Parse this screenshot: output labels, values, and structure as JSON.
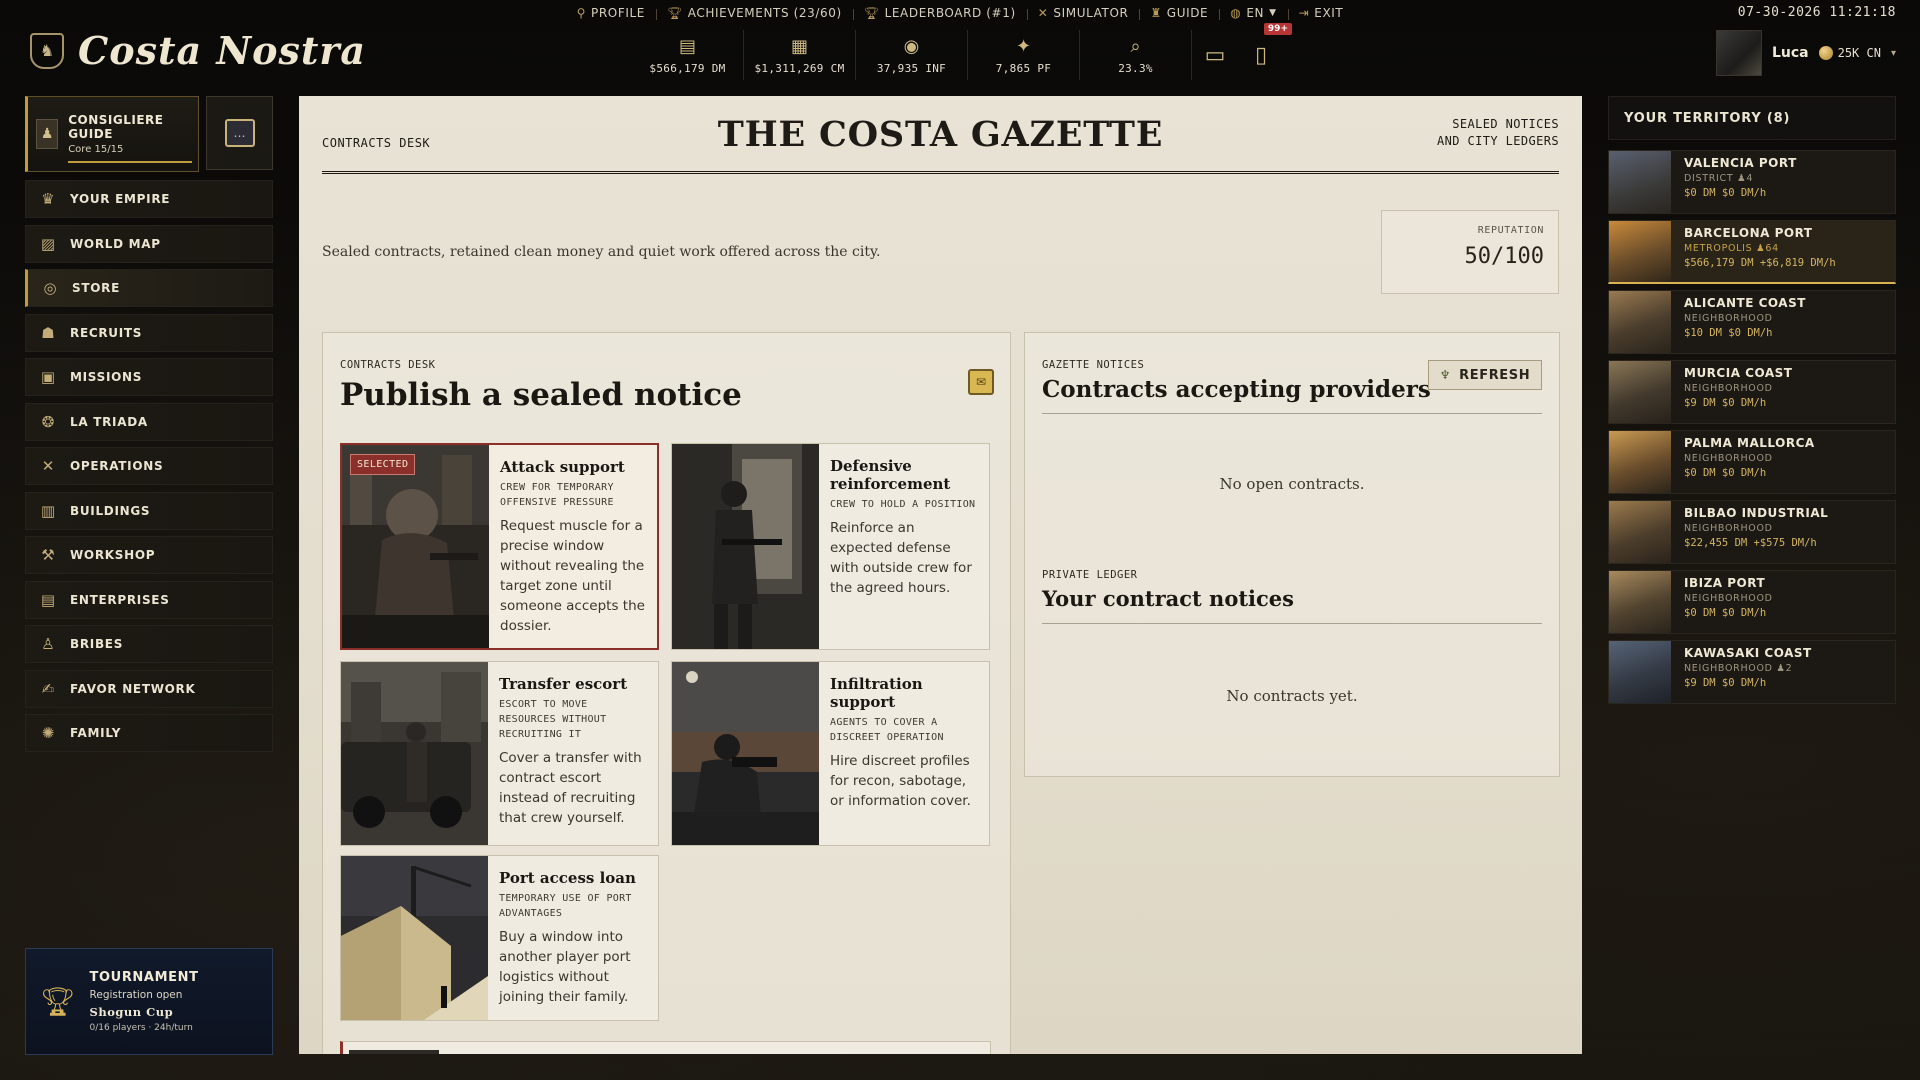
{
  "topmenu": {
    "profile": "PROFILE",
    "achievements": "ACHIEVEMENTS (23/60)",
    "leaderboard": "LEADERBOARD (#1)",
    "simulator": "SIMULATOR",
    "guide": "GUIDE",
    "language": "EN",
    "exit": "EXIT"
  },
  "datetime": "07-30-2026 11:21:18",
  "logo": {
    "name": "Costa Nostra"
  },
  "resources": [
    {
      "icon": "cash-icon",
      "value": "$566,179 DM"
    },
    {
      "icon": "cash-stack-icon",
      "value": "$1,311,269 CM"
    },
    {
      "icon": "influence-icon",
      "value": "37,935 INF"
    },
    {
      "icon": "favor-icon",
      "value": "7,865 PF"
    },
    {
      "icon": "search-icon",
      "value": "23.3%"
    }
  ],
  "notification_count": "99+",
  "user": {
    "name": "Luca",
    "balance": "25K CN"
  },
  "guide": {
    "title": "CONSIGLIERE GUIDE",
    "progress": "Core 15/15",
    "progress_fraction": 1.0
  },
  "nav": [
    {
      "label": "YOUR EMPIRE",
      "icon": "crown-icon"
    },
    {
      "label": "WORLD MAP",
      "icon": "map-icon"
    },
    {
      "label": "STORE",
      "icon": "coin-icon",
      "active": true
    },
    {
      "label": "RECRUITS",
      "icon": "recruits-icon"
    },
    {
      "label": "MISSIONS",
      "icon": "missions-icon"
    },
    {
      "label": "LA TRIADA",
      "icon": "triada-icon"
    },
    {
      "label": "OPERATIONS",
      "icon": "crossed-swords-icon"
    },
    {
      "label": "BUILDINGS",
      "icon": "building-icon"
    },
    {
      "label": "WORKSHOP",
      "icon": "workshop-icon"
    },
    {
      "label": "ENTERPRISES",
      "icon": "enterprise-icon"
    },
    {
      "label": "BRIBES",
      "icon": "bribe-icon"
    },
    {
      "label": "FAVOR NETWORK",
      "icon": "handshake-icon"
    },
    {
      "label": "FAMILY",
      "icon": "family-icon"
    }
  ],
  "tournament": {
    "title": "TOURNAMENT",
    "status": "Registration open",
    "name": "Shogun Cup",
    "info": "0/16 players · 24h/turn"
  },
  "gazette": {
    "left_label": "CONTRACTS DESK",
    "title": "THE COSTA GAZETTE",
    "right_label_1": "SEALED NOTICES",
    "right_label_2": "AND CITY LEDGERS",
    "intro": "Sealed contracts, retained clean money and quiet work offered across the city.",
    "reputation_label": "REPUTATION",
    "reputation_value": "50/100"
  },
  "publish": {
    "kicker": "CONTRACTS DESK",
    "title": "Publish a sealed notice",
    "selected_badge": "SELECTED",
    "cards": [
      {
        "title": "Attack support",
        "subtitle": "CREW FOR TEMPORARY OFFENSIVE PRESSURE",
        "desc": "Request muscle for a precise window without revealing the target zone until someone accepts the dossier.",
        "selected": true
      },
      {
        "title": "Defensive reinforcement",
        "subtitle": "CREW TO HOLD A POSITION",
        "desc": "Reinforce an expected defense with outside crew for the agreed hours."
      },
      {
        "title": "Transfer escort",
        "subtitle": "ESCORT TO MOVE RESOURCES WITHOUT RECRUITING IT",
        "desc": "Cover a transfer with contract escort instead of recruiting that crew yourself."
      },
      {
        "title": "Infiltration support",
        "subtitle": "AGENTS TO COVER A DISCREET OPERATION",
        "desc": "Hire discreet profiles for recon, sabotage, or information cover."
      },
      {
        "title": "Port access loan",
        "subtitle": "TEMPORARY USE OF PORT ADVANTAGES",
        "desc": "Buy a window into another player port logistics without joining their family."
      }
    ]
  },
  "notices": {
    "kicker": "GAZETTE NOTICES",
    "title": "Contracts accepting providers",
    "refresh": "REFRESH",
    "empty": "No open contracts.",
    "ledger_kicker": "PRIVATE LEDGER",
    "ledger_title": "Your contract notices",
    "ledger_empty": "No contracts yet."
  },
  "territory": {
    "title": "YOUR TERRITORY (8)",
    "items": [
      {
        "name": "VALENCIA PORT",
        "type": "DISTRICT",
        "extra": "4",
        "money": "$0 DM  $0 DM/h"
      },
      {
        "name": "BARCELONA PORT",
        "type": "METROPOLIS",
        "extra": "64",
        "money": "$566,179 DM  +$6,819 DM/h",
        "active": true
      },
      {
        "name": "ALICANTE COAST",
        "type": "NEIGHBORHOOD",
        "money": "$10 DM  $0 DM/h"
      },
      {
        "name": "MURCIA COAST",
        "type": "NEIGHBORHOOD",
        "money": "$9 DM  $0 DM/h"
      },
      {
        "name": "PALMA MALLORCA",
        "type": "NEIGHBORHOOD",
        "money": "$0 DM  $0 DM/h"
      },
      {
        "name": "BILBAO INDUSTRIAL",
        "type": "NEIGHBORHOOD",
        "money": "$22,455 DM  +$575 DM/h"
      },
      {
        "name": "IBIZA PORT",
        "type": "NEIGHBORHOOD",
        "money": "$0 DM  $0 DM/h"
      },
      {
        "name": "KAWASAKI COAST",
        "type": "NEIGHBORHOOD",
        "extra": "2",
        "money": "$9 DM  $0 DM/h"
      }
    ]
  },
  "colors": {
    "accent": "#c29b3c",
    "selected": "#8a2f2a",
    "paper": "#e6e0d1"
  }
}
